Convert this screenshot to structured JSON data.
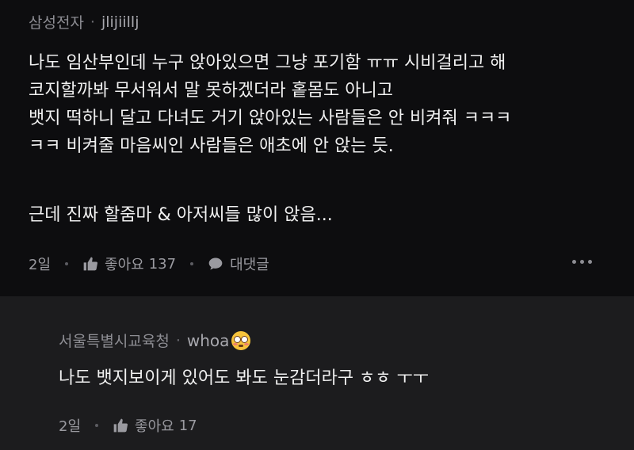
{
  "comment": {
    "company": "삼성전자",
    "separator": "·",
    "nickname": "jlijiillj",
    "lines": [
      "나도 임산부인데 누구 앉아있으면 그냥 포기함 ㅠㅠ 시비걸리고 해",
      "코지할까봐 무서워서 말 못하겠더라 홑몸도 아니고",
      "뱃지 떡하니 달고 다녀도 거기 앉아있는 사람들은 안 비켜줘 ㅋㅋㅋ",
      "ㅋㅋ 비켜줄 마음씨인 사람들은 애초에 안 앉는 듯.",
      "",
      "근데 진짜 할줌마 & 아저씨들 많이 앉음..."
    ],
    "time": "2일",
    "like_label": "좋아요",
    "like_count": "137",
    "reply_label": "대댓글"
  },
  "reply": {
    "company": "서울특별시교육청",
    "separator": "·",
    "nickname": "whoa",
    "emoji": "flushed-face",
    "text": "나도 뱃지보이게 있어도 봐도 눈감더라구 ㅎㅎ ㅜㅜ",
    "time": "2일",
    "like_label": "좋아요",
    "like_count": "17"
  },
  "colors": {
    "background": "#0d0d0f",
    "reply_background": "#1c1c1e",
    "text": "#f0f0f0",
    "muted": "#8d8d93"
  }
}
